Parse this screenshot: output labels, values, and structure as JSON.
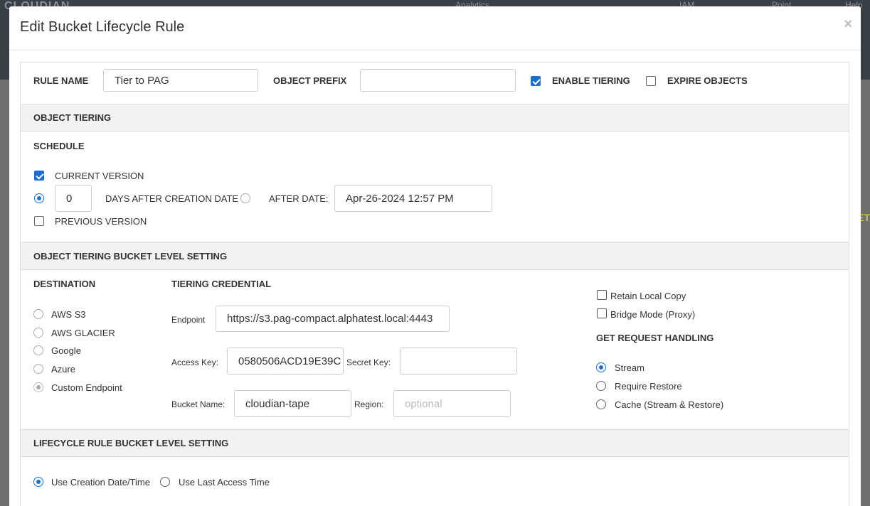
{
  "background": {
    "logo": "CLOUDIAN",
    "nav": [
      "Analytics",
      "IAM",
      "Point",
      "Help"
    ],
    "right_text": "ET"
  },
  "modal": {
    "title": "Edit Bucket Lifecycle Rule",
    "close": "×"
  },
  "rule": {
    "name_label": "RULE NAME",
    "name_value": "Tier to PAG",
    "prefix_label": "OBJECT PREFIX",
    "prefix_value": "",
    "enable_tiering_label": "ENABLE TIERING",
    "enable_tiering_checked": true,
    "expire_objects_label": "EXPIRE OBJECTS",
    "expire_objects_checked": false
  },
  "object_tiering": {
    "section_title": "OBJECT TIERING",
    "schedule_label": "SCHEDULE",
    "current_version_label": "CURRENT VERSION",
    "current_version_checked": true,
    "days_value": "0",
    "days_label": "DAYS AFTER CREATION DATE",
    "after_date_label": "AFTER DATE:",
    "after_date_value": "Apr-26-2024 12:57 PM",
    "previous_version_label": "PREVIOUS VERSION",
    "previous_version_checked": false
  },
  "bucket_setting": {
    "section_title": "OBJECT TIERING BUCKET LEVEL SETTING",
    "destination_label": "DESTINATION",
    "destinations": [
      "AWS S3",
      "AWS GLACIER",
      "Google",
      "Azure",
      "Custom Endpoint"
    ],
    "selected_destination": "Custom Endpoint",
    "credential_label": "TIERING CREDENTIAL",
    "endpoint_label": "Endpoint",
    "endpoint_value": "https://s3.pag-compact.alphatest.local:4443",
    "access_key_label": "Access Key:",
    "access_key_value": "0580506ACD19E39C",
    "secret_key_label": "Secret Key:",
    "secret_key_value": "",
    "bucket_name_label": "Bucket Name:",
    "bucket_name_value": "cloudian-tape",
    "region_label": "Region:",
    "region_placeholder": "optional",
    "retain_local_copy_label": "Retain Local Copy",
    "bridge_mode_label": "Bridge Mode (Proxy)",
    "get_request_label": "GET REQUEST HANDLING",
    "get_request_options": [
      "Stream",
      "Require Restore",
      "Cache (Stream & Restore)"
    ],
    "selected_get_request": "Stream"
  },
  "lifecycle_setting": {
    "section_title": "LIFECYCLE RULE BUCKET LEVEL SETTING",
    "options": [
      "Use Creation Date/Time",
      "Use Last Access Time"
    ],
    "selected": "Use Creation Date/Time"
  }
}
